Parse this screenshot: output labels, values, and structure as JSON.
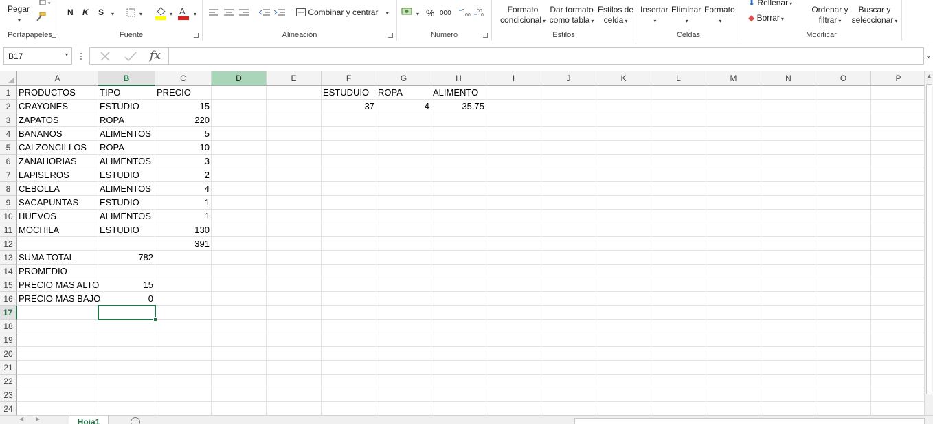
{
  "ribbon": {
    "clipboard": {
      "paste_label": "Pegar",
      "group_label": "Portapapeles"
    },
    "font": {
      "bold_label": "N",
      "italic_label": "K",
      "underline_label": "S",
      "group_label": "Fuente",
      "font_color": "#e0201c",
      "fill_color": "#ffff00"
    },
    "alignment": {
      "merge_label": "Combinar y centrar",
      "group_label": "Alineación"
    },
    "number": {
      "percent_label": "%",
      "thousands_label": "000",
      "group_label": "Número"
    },
    "styles": {
      "conditional_line1": "Formato",
      "conditional_line2": "condicional",
      "table_line1": "Dar formato",
      "table_line2": "como tabla",
      "cell_styles_line1": "Estilos de",
      "cell_styles_line2": "celda",
      "group_label": "Estilos"
    },
    "cells": {
      "insert_label": "Insertar",
      "delete_label": "Eliminar",
      "format_label": "Formato",
      "group_label": "Celdas"
    },
    "editing": {
      "fill_label": "Rellenar",
      "clear_label": "Borrar",
      "sort_line1": "Ordenar y",
      "sort_line2": "filtrar",
      "find_line1": "Buscar y",
      "find_line2": "seleccionar",
      "group_label": "Modificar"
    }
  },
  "formula_bar": {
    "name_box": "B17",
    "fx_label": "fx",
    "formula": ""
  },
  "grid": {
    "columns": [
      "A",
      "B",
      "C",
      "D",
      "E",
      "F",
      "G",
      "H",
      "I",
      "J",
      "K",
      "L",
      "M",
      "N",
      "O",
      "P"
    ],
    "rows": [
      "1",
      "2",
      "3",
      "4",
      "5",
      "6",
      "7",
      "8",
      "9",
      "10",
      "11",
      "12",
      "13",
      "14",
      "15",
      "16",
      "17",
      "18",
      "19",
      "20",
      "21",
      "22",
      "23",
      "24"
    ],
    "selected_cell": "B17",
    "cells": {
      "A1": "PRODUCTOS",
      "B1": "TIPO",
      "C1": "PRECIO",
      "A2": "CRAYONES",
      "B2": "ESTUDIO",
      "C2": "15",
      "A3": "ZAPATOS",
      "B3": "ROPA",
      "C3": "220",
      "A4": "BANANOS",
      "B4": "ALIMENTOS",
      "C4": "5",
      "A5": "CALZONCILLOS",
      "B5": "ROPA",
      "C5": "10",
      "A6": "ZANAHORIAS",
      "B6": "ALIMENTOS",
      "C6": "3",
      "A7": "LAPISEROS",
      "B7": "ESTUDIO",
      "C7": "2",
      "A8": "CEBOLLA",
      "B8": "ALIMENTOS",
      "C8": "4",
      "A9": "SACAPUNTAS",
      "B9": "ESTUDIO",
      "C9": "1",
      "A10": "HUEVOS",
      "B10": "ALIMENTOS",
      "C10": "1",
      "A11": "MOCHILA",
      "B11": "ESTUDIO",
      "C11": "130",
      "C12": "391",
      "A13": "SUMA TOTAL",
      "B13": "782",
      "A14": "PROMEDIO",
      "A15": "PRECIO MAS ALTO",
      "B15": "15",
      "A16": "PRECIO MAS BAJO",
      "B16": "0",
      "F1": "ESTUDUIO",
      "G1": "ROPA",
      "H1": "ALIMENTO",
      "F2": "37",
      "G2": "4",
      "H2": "35.75"
    },
    "numeric_cells": [
      "C2",
      "C3",
      "C4",
      "C5",
      "C6",
      "C7",
      "C8",
      "C9",
      "C10",
      "C11",
      "C12",
      "B13",
      "B15",
      "B16",
      "F2",
      "G2",
      "H2"
    ]
  },
  "sheet_tabs": [
    {
      "label": "Hoja1",
      "active": true
    }
  ],
  "colors": {
    "accent": "#217346",
    "selected_column_header": "#a9d6b8"
  }
}
